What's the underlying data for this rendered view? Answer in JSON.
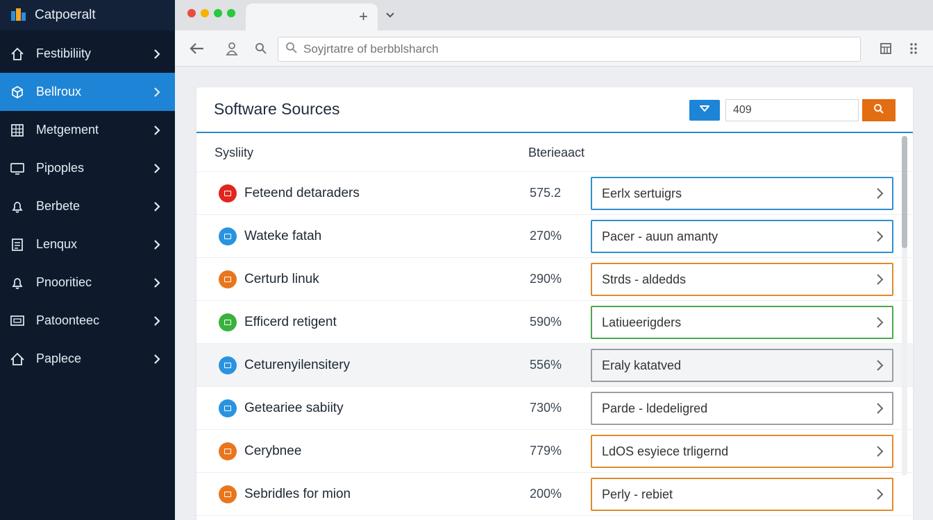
{
  "app": {
    "brand": "Catpoeralt"
  },
  "sidebar": {
    "items": [
      {
        "label": "Festibiliity",
        "icon": "home-icon",
        "active": false
      },
      {
        "label": "Bellroux",
        "icon": "package-icon",
        "active": true
      },
      {
        "label": "Metgement",
        "icon": "grid-icon",
        "active": false
      },
      {
        "label": "Pipoples",
        "icon": "monitor-icon",
        "active": false
      },
      {
        "label": "Berbete",
        "icon": "bell-icon",
        "active": false
      },
      {
        "label": "Lenqux",
        "icon": "document-icon",
        "active": false
      },
      {
        "label": "Pnooritiec",
        "icon": "bell-icon",
        "active": false
      },
      {
        "label": "Patoonteec",
        "icon": "screen-icon",
        "active": false
      },
      {
        "label": "Paplece",
        "icon": "house-icon",
        "active": false
      }
    ]
  },
  "browser": {
    "window_controls": [
      "#e94b3c",
      "#f5b400",
      "#27c93f",
      "#27c93f"
    ],
    "new_tab": "+",
    "url_placeholder": "Soyjrtatre of berbblsharch"
  },
  "card": {
    "title": "Software Sources",
    "number_value": "409",
    "columns": {
      "name": "Sysliity",
      "value": "Bterieaact"
    },
    "rows": [
      {
        "name": "Feteend detaraders",
        "value": "575.2",
        "status": "Eerlx sertuigrs",
        "color": "#e0261f",
        "border": "#2f8fce",
        "highlight": false
      },
      {
        "name": "Wateke fatah",
        "value": "270%",
        "status": "Pacer - auun amanty",
        "color": "#2a93e0",
        "border": "#2f8fce",
        "highlight": false
      },
      {
        "name": "Certurb linuk",
        "value": "290%",
        "status": "Strds - aldedds",
        "color": "#e9761c",
        "border": "#e08a2a",
        "highlight": false
      },
      {
        "name": "Efficerd retigent",
        "value": "590%",
        "status": "Latiueerigders",
        "color": "#38b23c",
        "border": "#4aa84a",
        "highlight": false
      },
      {
        "name": "Ceturenyilensitery",
        "value": "556%",
        "status": "Eraly katatved",
        "color": "#2a93e0",
        "border": "#9a9ea4",
        "highlight": true
      },
      {
        "name": "Geteariee sabiity",
        "value": "730%",
        "status": "Parde - ldedeligred",
        "color": "#2a93e0",
        "border": "#9a9ea4",
        "highlight": false
      },
      {
        "name": "Cerybnee",
        "value": "779%",
        "status": "LdOS esyiece trligernd",
        "color": "#e9761c",
        "border": "#e08a2a",
        "highlight": false
      },
      {
        "name": "Sebridles for mion",
        "value": "200%",
        "status": "Perly - rebiet",
        "color": "#e9761c",
        "border": "#e08a2a",
        "highlight": false
      }
    ]
  },
  "colors": {
    "sidebar_bg": "#0e1a2c",
    "accent": "#1e84d6",
    "search_btn": "#e36d12"
  }
}
